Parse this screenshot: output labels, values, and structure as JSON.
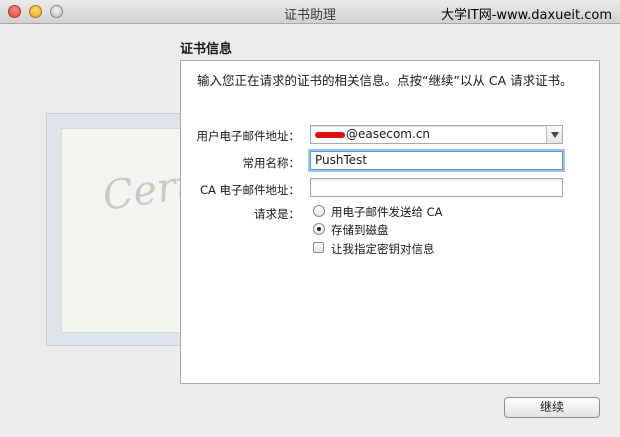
{
  "window": {
    "title": "证书助理",
    "watermark": "大学IT网-www.daxueit.com"
  },
  "section": {
    "title": "证书信息"
  },
  "description": "输入您正在请求的证书的相关信息。点按“继续”以从 CA 请求证书。",
  "background": {
    "certificate_script": "Certificate"
  },
  "form": {
    "user_email": {
      "label": "用户电子邮件地址：",
      "value": "@easecom.cn"
    },
    "common_name": {
      "label": "常用名称：",
      "value": "PushTest"
    },
    "ca_email": {
      "label": "CA 电子邮件地址：",
      "value": ""
    },
    "request": {
      "label": "请求是：",
      "options": [
        {
          "label": "用电子邮件发送给 CA",
          "selected": false
        },
        {
          "label": "存储到磁盘",
          "selected": true
        }
      ],
      "checkbox": {
        "label": "让我指定密钥对信息",
        "checked": false
      }
    }
  },
  "buttons": {
    "continue": "继续"
  },
  "colors": {
    "focus_ring": "#9cc3ee",
    "redaction": "#dd1111"
  }
}
